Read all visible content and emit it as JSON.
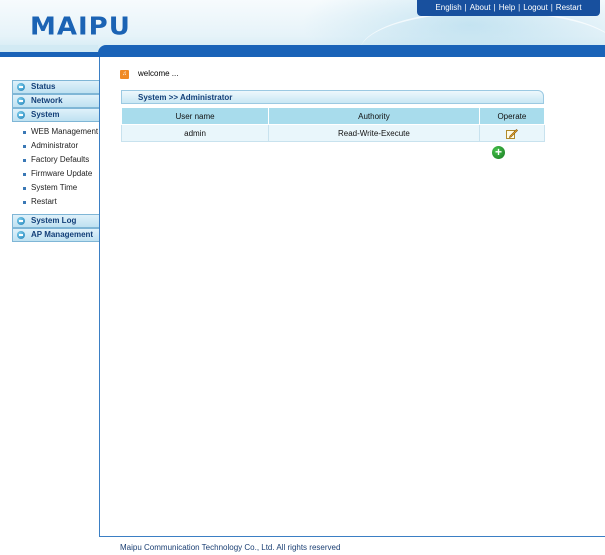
{
  "logo": {
    "text": "MAIPU"
  },
  "topnav": {
    "items": [
      "English",
      "About",
      "Help",
      "Logout",
      "Restart"
    ],
    "separator": "|"
  },
  "sidebar": {
    "sections": [
      {
        "label": "Status"
      },
      {
        "label": "Network"
      },
      {
        "label": "System"
      },
      {
        "label": "System Log"
      },
      {
        "label": "AP Management"
      }
    ],
    "system_items": [
      "WEB Management",
      "Administrator",
      "Factory Defaults",
      "Firmware Update",
      "System Time",
      "Restart"
    ]
  },
  "content": {
    "welcome": "welcome ...",
    "panel_title": "System >> Administrator",
    "table": {
      "headers": [
        "User name",
        "Authority",
        "Operate"
      ],
      "rows": [
        {
          "user": "admin",
          "authority": "Read-Write-Execute"
        }
      ]
    }
  },
  "footer": {
    "text": "Maipu Communication Technology Co., Ltd. All rights reserved"
  },
  "colors": {
    "brand_blue": "#1a63b8",
    "nav_bg": "#18509e",
    "table_header": "#a8dcec",
    "table_row": "#e9f6fb",
    "welcome_icon": "#f08a24",
    "add_icon": "#1a7a23"
  },
  "icons": {
    "welcome": "speaker-icon",
    "edit": "edit-pencil-icon",
    "add": "add-circle-icon",
    "section": "circle-bullet-icon"
  }
}
